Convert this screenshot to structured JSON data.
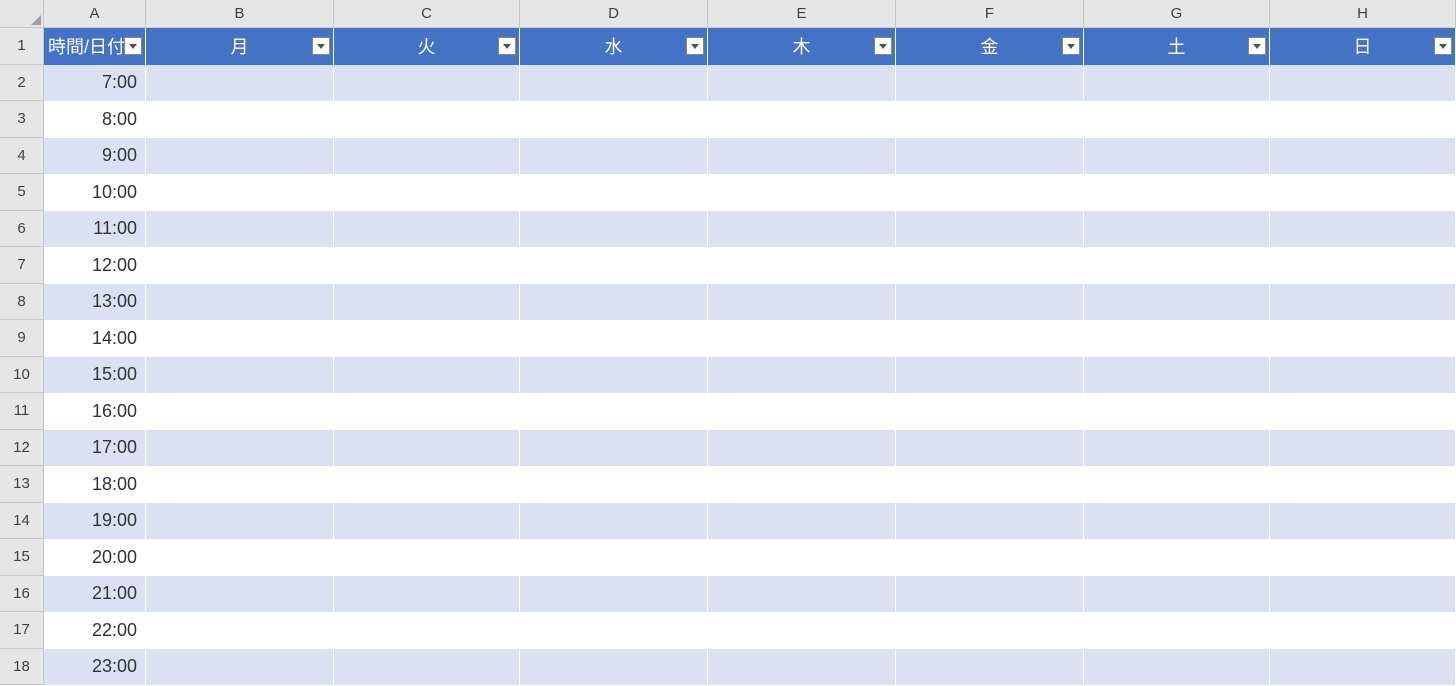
{
  "columns": [
    "A",
    "B",
    "C",
    "D",
    "E",
    "F",
    "G",
    "H"
  ],
  "rows": [
    "1",
    "2",
    "3",
    "4",
    "5",
    "6",
    "7",
    "8",
    "9",
    "10",
    "11",
    "12",
    "13",
    "14",
    "15",
    "16",
    "17",
    "18"
  ],
  "tableHeaders": [
    "時間/日付",
    "月",
    "火",
    "水",
    "木",
    "金",
    "土",
    "日"
  ],
  "timeValues": [
    "7:00",
    "8:00",
    "9:00",
    "10:00",
    "11:00",
    "12:00",
    "13:00",
    "14:00",
    "15:00",
    "16:00",
    "17:00",
    "18:00",
    "19:00",
    "20:00",
    "21:00",
    "22:00",
    "23:00"
  ],
  "colors": {
    "headerBg": "#4472c4",
    "bandEven": "#d9e1f2",
    "bandOdd": "#ffffff",
    "gridHeader": "#e6e6e6"
  }
}
